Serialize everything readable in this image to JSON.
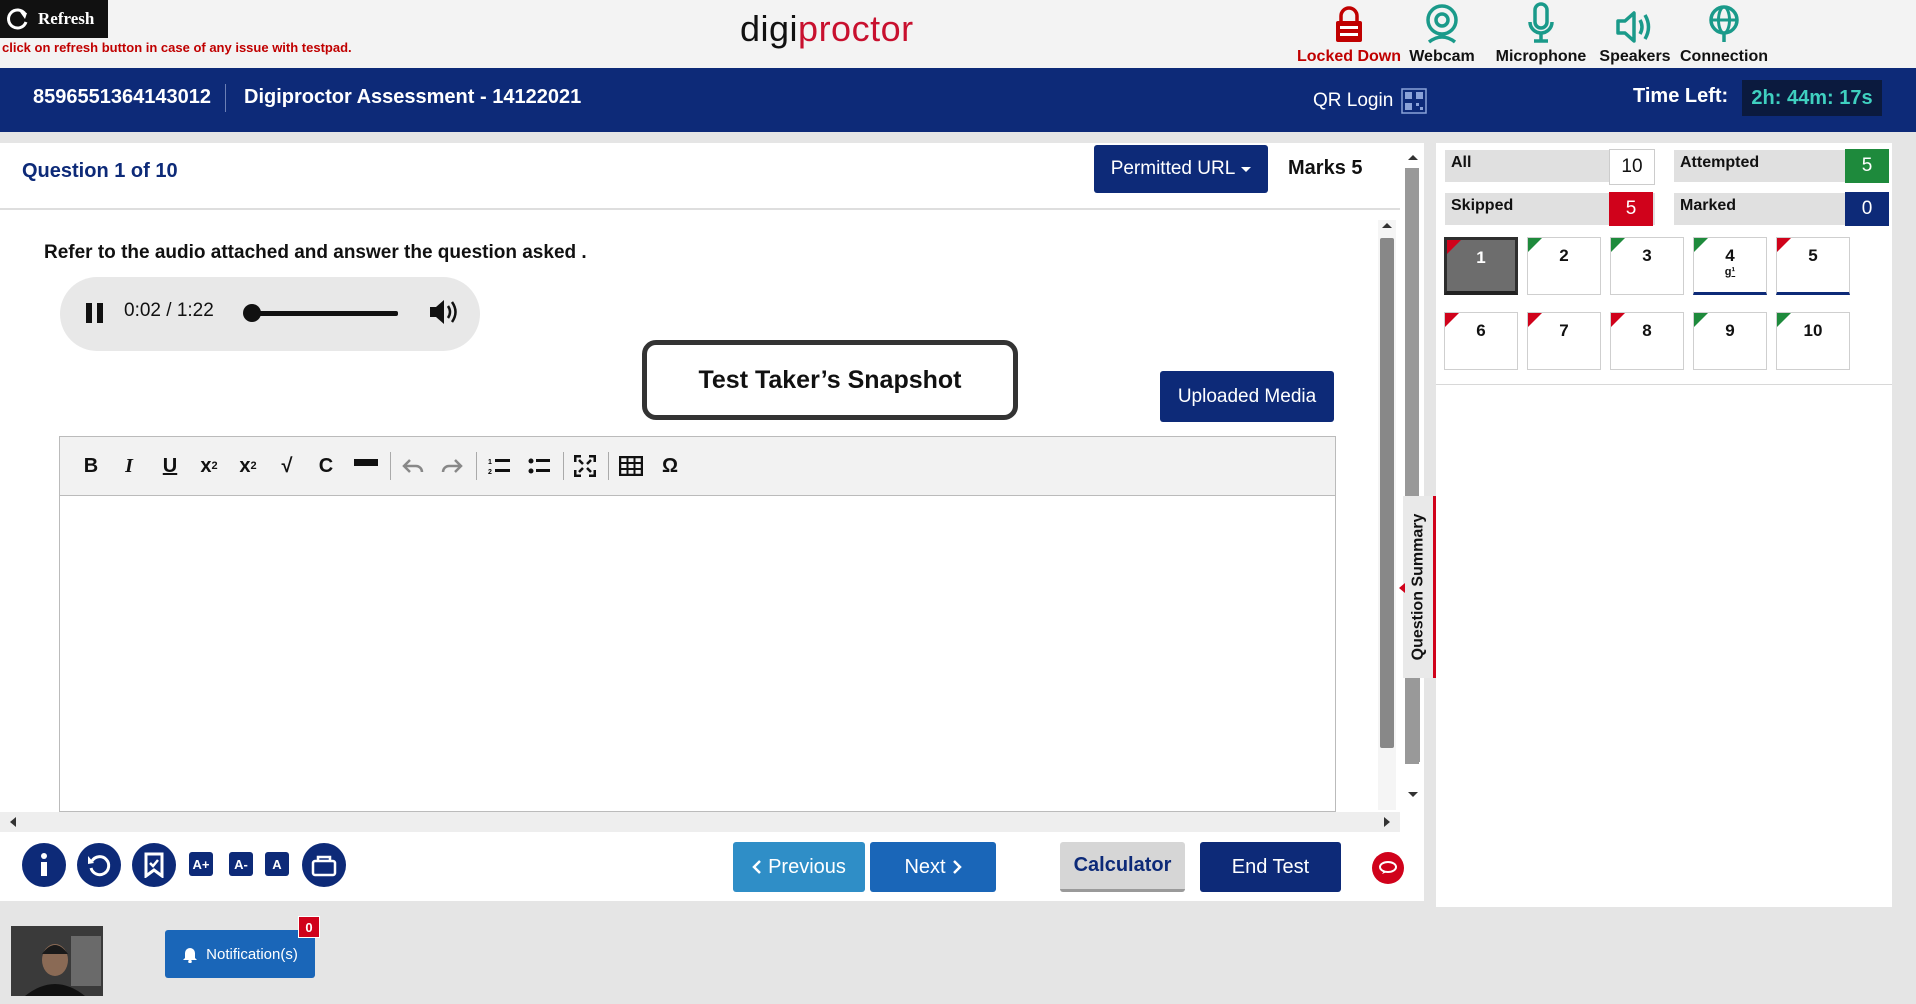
{
  "header": {
    "refresh_label": "Refresh",
    "refresh_hint": "click on refresh button in case of any issue with testpad.",
    "brand_part1": "digi",
    "brand_part2": "proctor",
    "status_items": [
      {
        "label": "Locked Down",
        "icon": "lock-icon"
      },
      {
        "label": "Webcam",
        "icon": "webcam-icon"
      },
      {
        "label": "Microphone",
        "icon": "microphone-icon"
      },
      {
        "label": "Speakers",
        "icon": "speaker-icon"
      },
      {
        "label": "Connection",
        "icon": "connection-icon"
      }
    ],
    "status_colors": {
      "alert": "#c00000",
      "ok": "#1a9a8a"
    }
  },
  "assessment_bar": {
    "candidate_id": "8596551364143012",
    "test_name": "Digiproctor Assessment - 14122021",
    "qr_login_label": "QR Login",
    "time_left_label": "Time Left:",
    "time_left_value": "2h: 44m: 17s"
  },
  "question": {
    "number_label": "Question 1 of 10",
    "permitted_url_label": "Permitted URL",
    "marks_label": "Marks 5",
    "text": "Refer to the audio attached and answer the question asked .",
    "audio": {
      "time": "0:02 / 1:22",
      "progress": 0.024
    },
    "snapshot_label": "Test Taker’s Snapshot",
    "uploaded_media_label": "Uploaded Media",
    "editor_value": ""
  },
  "summary_tab_label": "Question Summary",
  "footer_nav": {
    "previous_label": "Previous",
    "next_label": "Next",
    "calculator_label": "Calculator",
    "end_test_label": "End Test",
    "font_buttons": [
      "A+",
      "A-",
      "A"
    ]
  },
  "summary": {
    "all_label": "All",
    "all_count": "10",
    "attempted_label": "Attempted",
    "attempted_count": "5",
    "skipped_label": "Skipped",
    "skipped_count": "5",
    "marked_label": "Marked",
    "marked_count": "0",
    "colors": {
      "attempted": "#1e8a3c",
      "skipped": "#d0021b",
      "marked": "#0d2a78",
      "brand": "#0d2a78"
    },
    "questions": [
      {
        "num": "1",
        "status": "skipped",
        "current": true
      },
      {
        "num": "2",
        "status": "attempted"
      },
      {
        "num": "3",
        "status": "attempted"
      },
      {
        "num": "4",
        "status": "attempted",
        "note": "g¹"
      },
      {
        "num": "5",
        "status": "skipped"
      },
      {
        "num": "6",
        "status": "skipped"
      },
      {
        "num": "7",
        "status": "skipped"
      },
      {
        "num": "8",
        "status": "skipped"
      },
      {
        "num": "9",
        "status": "attempted"
      },
      {
        "num": "10",
        "status": "attempted"
      }
    ]
  },
  "notification": {
    "label": "Notification(s)",
    "count": "0"
  }
}
